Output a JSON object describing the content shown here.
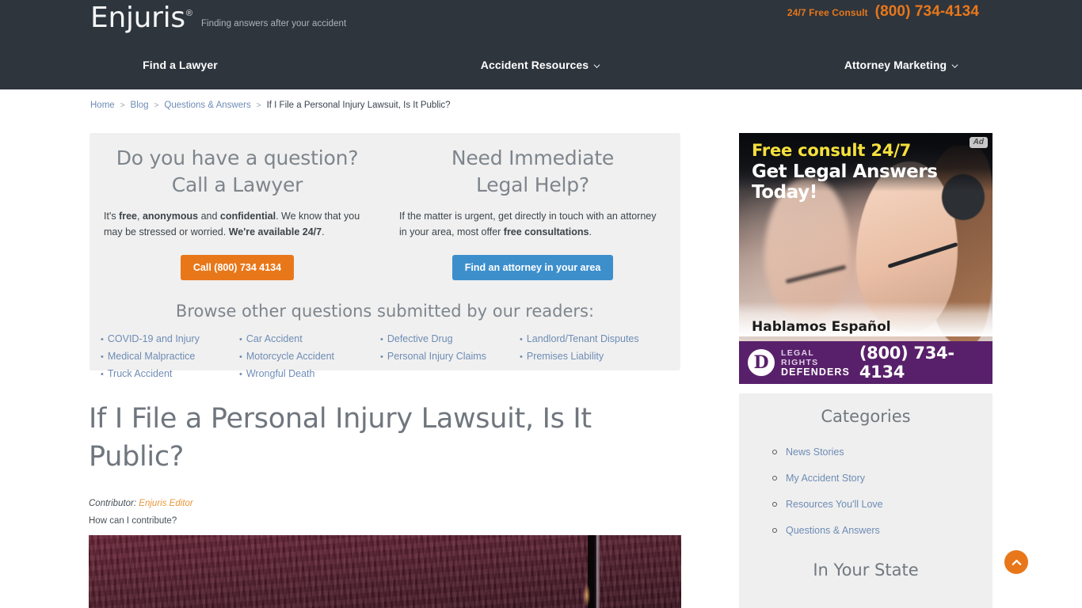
{
  "header": {
    "logo_word": "Enjuris",
    "logo_reg": "®",
    "tagline": "Finding answers after your accident",
    "consult_label": "24/7 Free Consult",
    "consult_phone": "(800) 734-4134",
    "nav": [
      {
        "label": "Find a Lawyer",
        "has_chevron": false
      },
      {
        "label": "Accident Resources",
        "has_chevron": true
      },
      {
        "label": "Attorney Marketing",
        "has_chevron": true
      }
    ]
  },
  "breadcrumb": {
    "items": [
      "Home",
      "Blog",
      "Questions & Answers"
    ],
    "separator": ">",
    "current": "If I File a Personal Injury Lawsuit, Is It Public?"
  },
  "callout": {
    "left": {
      "heading_line1": "Do you have a question?",
      "heading_line2": "Call a Lawyer",
      "body_pre": "It's ",
      "body_b1": "free",
      "body_mid1": ", ",
      "body_b2": "anonymous",
      "body_mid2": " and ",
      "body_b3": "confidential",
      "body_mid3": ". We know that you may be stressed or worried. ",
      "body_b4": "We're available 24/7",
      "body_end": ".",
      "button_label": "Call (800) 734 4134"
    },
    "right": {
      "heading_line1": "Need Immediate",
      "heading_line2": "Legal Help?",
      "body_pre": "If the matter is urgent, get directly in touch with an attorney in your area, most offer ",
      "body_b1": "free consultations",
      "body_end": ".",
      "button_label": "Find an attorney in your area"
    },
    "browse_heading": "Browse other questions submitted by our readers:",
    "link_columns": [
      [
        "COVID-19 and Injury",
        "Medical Malpractice",
        "Truck Accident"
      ],
      [
        "Car Accident",
        "Motorcycle Accident",
        "Wrongful Death"
      ],
      [
        "Defective Drug",
        "Personal Injury Claims"
      ],
      [
        "Landlord/Tenant Disputes",
        "Premises Liability"
      ]
    ]
  },
  "article": {
    "title": "If I File a Personal Injury Lawsuit, Is It Public?",
    "contributor_label": "Contributor:",
    "contributor_name": "Enjuris Editor",
    "contribute_link": "How can I contribute?"
  },
  "ad": {
    "badge": "Ad",
    "line1": "Free consult 24/7",
    "line2": "Get Legal Answers Today!",
    "espanol": "Hablamos Español",
    "brand_mark": "D",
    "brand_line1": "LEGAL RIGHTS",
    "brand_line2": "DEFENDERS",
    "phone": "(800) 734-4134"
  },
  "sidebar": {
    "categories_title": "Categories",
    "categories": [
      "News Stories",
      "My Accident Story",
      "Resources You'll Love",
      "Questions & Answers"
    ],
    "state_title": "In Your State"
  },
  "colors": {
    "header_bg": "#2e353d",
    "accent_orange": "#e8771a",
    "accent_blue": "#3d8fcc",
    "link_blue": "#6e8cb5",
    "panel_gray": "#f0f0f0",
    "ad_purple": "#58206a",
    "ad_yellow": "#f5e03c"
  }
}
